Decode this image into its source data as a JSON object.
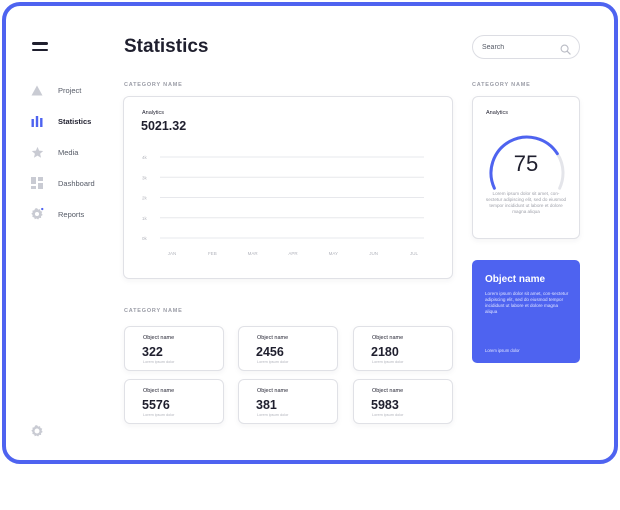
{
  "colors": {
    "accent": "#4e63f0",
    "text": "#1f1f2e",
    "muted": "#9a9ca6",
    "grid": "#e7e8ec"
  },
  "sidebar": {
    "items": [
      {
        "label": "Project",
        "icon": "triangle-icon",
        "active": false
      },
      {
        "label": "Statistics",
        "icon": "bar-chart-icon",
        "active": true
      },
      {
        "label": "Media",
        "icon": "star-icon",
        "active": false
      },
      {
        "label": "Dashboard",
        "icon": "grid-icon",
        "active": false
      },
      {
        "label": "Reports",
        "icon": "gear-icon",
        "active": false
      }
    ],
    "bottom_icon": "settings-icon"
  },
  "header": {
    "title": "Statistics"
  },
  "search": {
    "placeholder": "Search",
    "icon": "search-icon"
  },
  "sections": {
    "main_label": "CATEGORY NAME",
    "right_label": "CATEGORY NAME",
    "bottom_label": "CATEGORY NAME"
  },
  "analytics": {
    "label": "Analytics",
    "value": "5021.32"
  },
  "chart_data": {
    "type": "line",
    "categories": [
      "JAN",
      "FEB",
      "MAR",
      "APR",
      "MAY",
      "JUN",
      "JUL"
    ],
    "ytick_labels": [
      "4k",
      "3k",
      "2k",
      "1k",
      "0k"
    ],
    "series": [],
    "grid": true
  },
  "gauge": {
    "label": "Analytics",
    "value": "75",
    "percent": 75,
    "description": "Lorem ipsum dolor sit amet, con-sectetur adipiscing elit, sed do eiusmod tempor incididunt ut labore et dolore magna aliqua"
  },
  "highlight": {
    "title": "Object name",
    "description": "Lorem ipsum dolor sit amet, con-sectetur adipiscing elit, sed do eiusmod tempor incididunt ut labore et dolore magna aliqua",
    "link": "Lorem ipsum dolor"
  },
  "stats": [
    {
      "label": "Object name",
      "value": "322",
      "sub": "Lorem ipsum dolor"
    },
    {
      "label": "Object name",
      "value": "2456",
      "sub": "Lorem ipsum dolor"
    },
    {
      "label": "Object name",
      "value": "2180",
      "sub": "Lorem ipsum dolor"
    },
    {
      "label": "Object name",
      "value": "5576",
      "sub": "Lorem ipsum dolor"
    },
    {
      "label": "Object name",
      "value": "381",
      "sub": "Lorem ipsum dolor"
    },
    {
      "label": "Object name",
      "value": "5983",
      "sub": "Lorem ipsum dolor"
    }
  ]
}
